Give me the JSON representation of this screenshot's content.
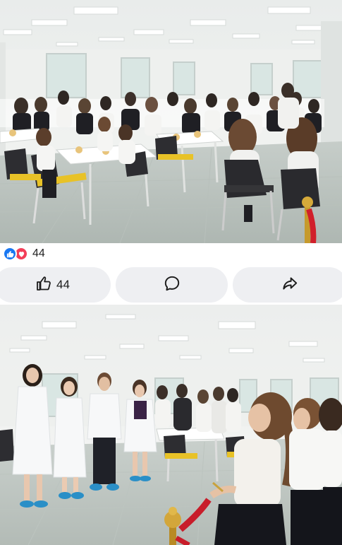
{
  "post": {
    "reactions": {
      "types": [
        "like-icon",
        "love-icon"
      ],
      "count": "44",
      "colors": {
        "like": "#1877f2",
        "love": "#f33e58"
      }
    },
    "actions": {
      "like_count": "44",
      "icons": [
        "thumbs-up-icon",
        "comment-bubble-icon",
        "share-arrow-icon"
      ]
    },
    "photos": [
      {
        "subject": "school-cafeteria-students-at-tables"
      },
      {
        "subject": "ribbon-cutting-ceremony-in-cafeteria"
      }
    ]
  }
}
